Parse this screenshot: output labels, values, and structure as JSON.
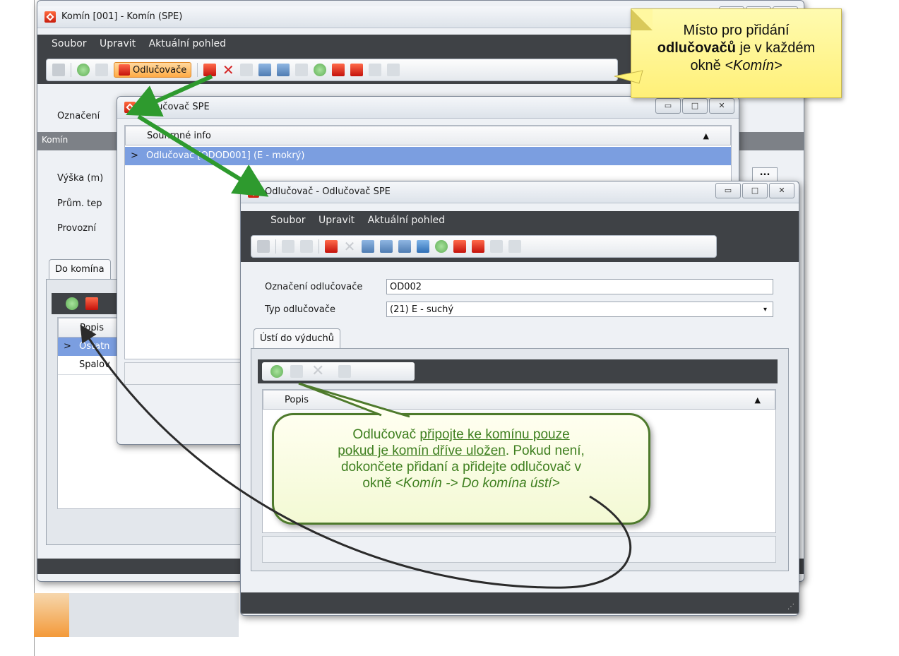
{
  "main_window": {
    "title": "Komín [001] - Komín (SPE)",
    "menu": [
      "Soubor",
      "Upravit",
      "Aktuální pohled"
    ],
    "toolbar_highlight_label": "Odlučovače",
    "label_oznaceni": "Označení",
    "section_komin": "Komín",
    "label_vyska": "Výška (m)",
    "label_prum": "Prům. tep",
    "label_provozni": "Provozní",
    "tab_do_komina": "Do komína",
    "grid_header_popis": "Popis",
    "grid_row_1": "Ostatn",
    "grid_row_2": "Spalov",
    "ellipsis": "..."
  },
  "list_window": {
    "title": "Odlučovač SPE",
    "header": "Souhrnné info",
    "selected_row": "Odlučovač [ODOD001] (E - mokrý)"
  },
  "detail_window": {
    "title": "Odlučovač - Odlučovač SPE",
    "menu": [
      "Soubor",
      "Upravit",
      "Aktuální pohled"
    ],
    "label_oznaceni": "Označení odlučovače",
    "value_oznaceni": "OD002",
    "label_typ": "Typ odlučovače",
    "value_typ": "(21) E - suchý",
    "tab_label": "Ústí do výduchů",
    "grid_header": "Popis"
  },
  "callout_yellow": {
    "line1": "Místo pro přidání",
    "bold": "odlučovačů",
    "line2_rest": " je v každém",
    "line3_pre": "okně ",
    "line3_em": "<Komín>"
  },
  "callout_green": {
    "t1": "Odlučovač ",
    "u1": "připojte ke komínu pouze",
    "u2": "pokud je komín dříve uložen",
    "t2": ". Pokud není,",
    "t3": "dokončete přidaní a přidejte odlučovač v",
    "t4": "okně ",
    "em": "<Komín -> Do komína ústí>"
  },
  "colors": {
    "menubar": "#3f4246",
    "selection": "#7b9ee0",
    "arrow_green": "#2e9a2e",
    "note_yellow": "#fff37a",
    "bubble_border": "#4e7a2c",
    "bubble_text": "#3e7f1f"
  }
}
